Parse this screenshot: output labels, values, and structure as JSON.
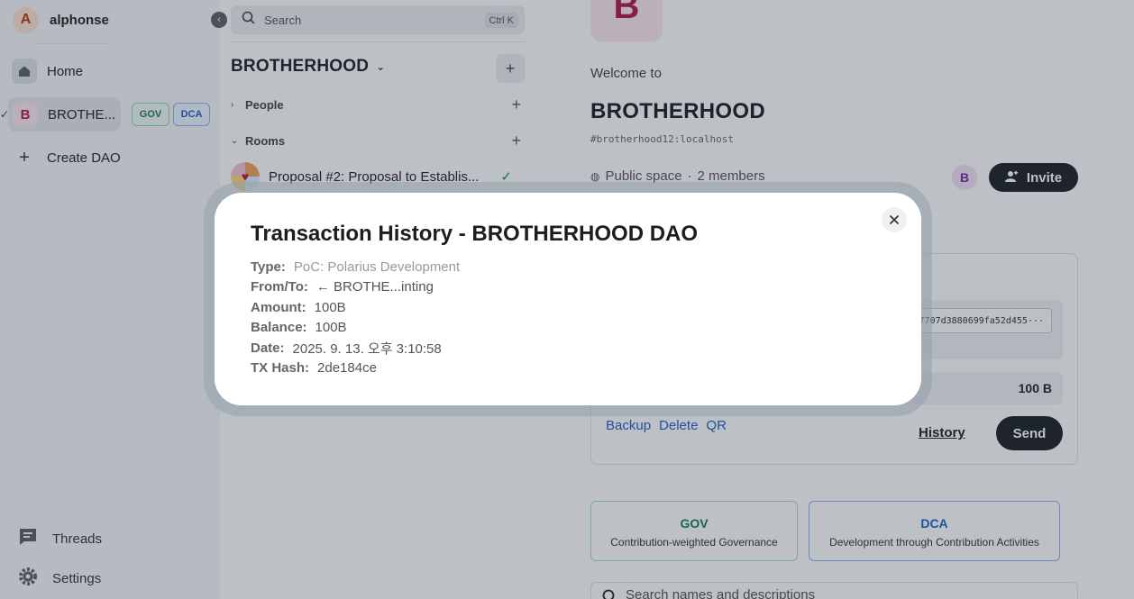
{
  "sidebar": {
    "user": {
      "initial": "A",
      "name": "alphonse"
    },
    "items": [
      {
        "label": "Home",
        "icon": "home-icon"
      },
      {
        "label": "BROTHE...",
        "initial": "B",
        "badges": [
          "GOV",
          "DCA"
        ]
      },
      {
        "label": "Create DAO",
        "icon": "plus-icon"
      }
    ],
    "bottom": [
      {
        "label": "Threads",
        "icon": "threads-icon"
      },
      {
        "label": "Settings",
        "icon": "gear-icon"
      }
    ]
  },
  "rooms_panel": {
    "search_placeholder": "Search",
    "shortcut": "Ctrl K",
    "space_name": "BROTHERHOOD",
    "sections": [
      {
        "label": "People"
      },
      {
        "label": "Rooms"
      }
    ],
    "rooms": [
      {
        "name": "Proposal #2: Proposal to Establis...",
        "status": "✓"
      }
    ]
  },
  "main": {
    "avatar_initial": "B",
    "welcome": "Welcome to",
    "space_name": "BROTHERHOOD",
    "alias": "#brotherhood12:localhost",
    "visibility": "Public space",
    "members": "2 members",
    "member_initial": "B",
    "invite_label": "Invite",
    "wallet": {
      "address": "7707d3880699fa52d455···",
      "balance": "100 B",
      "links": [
        "Backup",
        "Delete",
        "QR"
      ],
      "history_label": "History",
      "send_label": "Send"
    },
    "cards": [
      {
        "title": "GOV",
        "subtitle": "Contribution-weighted Governance"
      },
      {
        "title": "DCA",
        "subtitle": "Development through Contribution Activities"
      }
    ],
    "search_placeholder": "Search names and descriptions"
  },
  "modal": {
    "title": "Transaction History - BROTHERHOOD DAO",
    "close_icon": "close-icon",
    "rows": [
      {
        "label": "Type:",
        "value": "PoC: Polarius Development"
      },
      {
        "label": "From/To:",
        "value": "← BROTHE...inting"
      },
      {
        "label": "Amount:",
        "value": "100B"
      },
      {
        "label": "Balance:",
        "value": "100B"
      },
      {
        "label": "Date:",
        "value": "2025. 9. 13. 오후 3:10:58"
      },
      {
        "label": "TX Hash:",
        "value": "2de184ce"
      }
    ]
  }
}
